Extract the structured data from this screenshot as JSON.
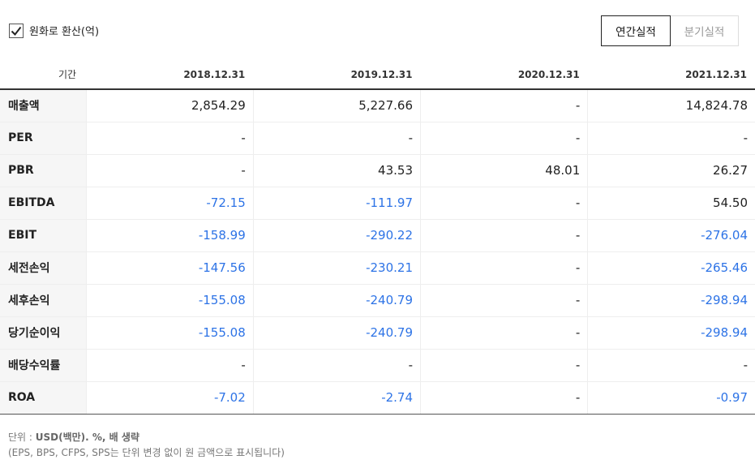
{
  "toggle": {
    "label": "원화로 환산(억)",
    "checked": true
  },
  "tabs": {
    "annual": "연간실적",
    "quarter": "분기실적"
  },
  "table": {
    "period_header": "기간",
    "columns": [
      "2018.12.31",
      "2019.12.31",
      "2020.12.31",
      "2021.12.31"
    ],
    "rows": [
      {
        "label": "매출액",
        "values": [
          "2,854.29",
          "5,227.66",
          "-",
          "14,824.78"
        ]
      },
      {
        "label": "PER",
        "values": [
          "-",
          "-",
          "-",
          "-"
        ]
      },
      {
        "label": "PBR",
        "values": [
          "-",
          "43.53",
          "48.01",
          "26.27"
        ]
      },
      {
        "label": "EBITDA",
        "values": [
          "-72.15",
          "-111.97",
          "-",
          "54.50"
        ]
      },
      {
        "label": "EBIT",
        "values": [
          "-158.99",
          "-290.22",
          "-",
          "-276.04"
        ]
      },
      {
        "label": "세전손익",
        "values": [
          "-147.56",
          "-230.21",
          "-",
          "-265.46"
        ]
      },
      {
        "label": "세후손익",
        "values": [
          "-155.08",
          "-240.79",
          "-",
          "-298.94"
        ]
      },
      {
        "label": "당기순이익",
        "values": [
          "-155.08",
          "-240.79",
          "-",
          "-298.94"
        ]
      },
      {
        "label": "배당수익률",
        "values": [
          "-",
          "-",
          "-",
          "-"
        ]
      },
      {
        "label": "ROA",
        "values": [
          "-7.02",
          "-2.74",
          "-",
          "-0.97"
        ]
      }
    ]
  },
  "footnote": {
    "unit_prefix": "단위 : ",
    "unit_value": "USD(백만). %, 배 생략",
    "note": "(EPS, BPS, CFPS, SPS는 단위 변경 없이 원 금액으로 표시됩니다)"
  },
  "colors": {
    "negative": "#2d73e6",
    "text": "#222222"
  }
}
